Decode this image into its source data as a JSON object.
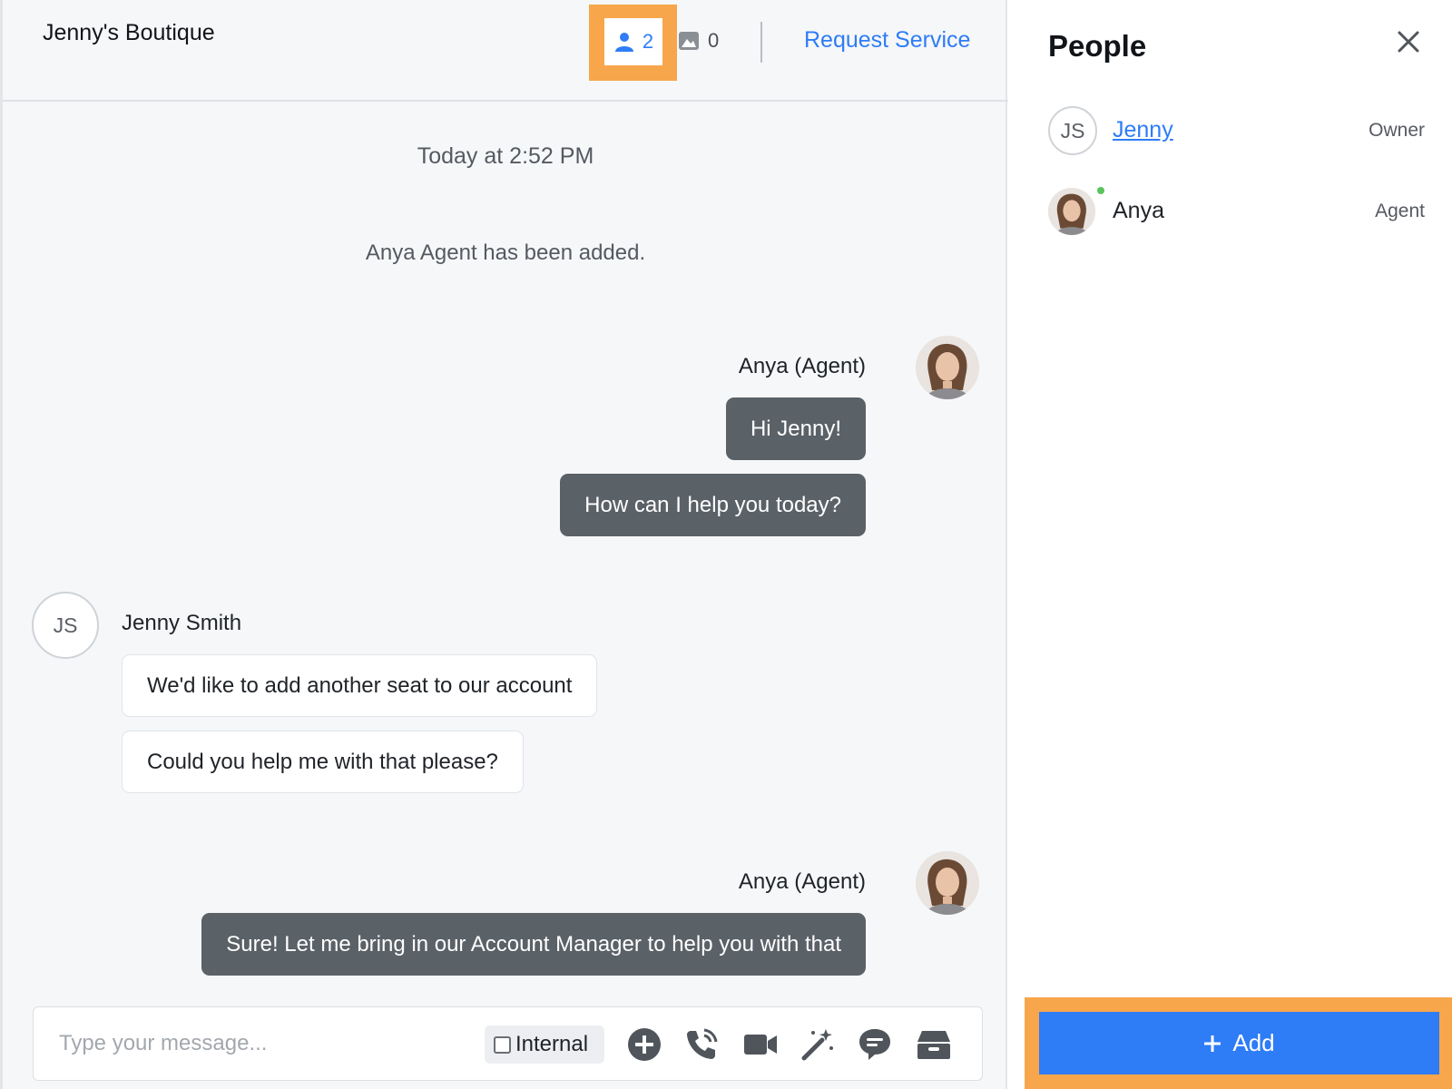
{
  "header": {
    "business_name": "Jenny's Boutique",
    "participants_count": "2",
    "media_count": "0",
    "request_service_label": "Request Service"
  },
  "conversation": {
    "timestamp": "Today at 2:52 PM",
    "system_message": "Anya Agent has been added.",
    "groups": [
      {
        "sender": "Anya (Agent)",
        "messages": [
          "Hi Jenny!",
          "How can I help you today?"
        ]
      },
      {
        "sender": "Jenny Smith",
        "initials": "JS",
        "messages": [
          "We'd like to add another seat to our account",
          "Could you help me with that please?"
        ]
      },
      {
        "sender": "Anya (Agent)",
        "messages": [
          "Sure! Let me bring in our Account Manager to help you with that"
        ]
      }
    ]
  },
  "composer": {
    "placeholder": "Type your message...",
    "internal_label": "Internal",
    "tools": [
      "plus-circle-icon",
      "phone-icon",
      "video-camera-icon",
      "magic-wand-icon",
      "chat-bubble-icon",
      "archive-box-icon"
    ]
  },
  "people_panel": {
    "title": "People",
    "people": [
      {
        "initials": "JS",
        "name": "Jenny",
        "role": "Owner"
      },
      {
        "name": "Anya",
        "role": "Agent",
        "online": true
      }
    ],
    "add_label": "Add"
  },
  "colors": {
    "accent": "#2e7cf6",
    "agent_bubble": "#5a6167",
    "highlight": "#f7a64b",
    "online": "#5bc35b"
  }
}
